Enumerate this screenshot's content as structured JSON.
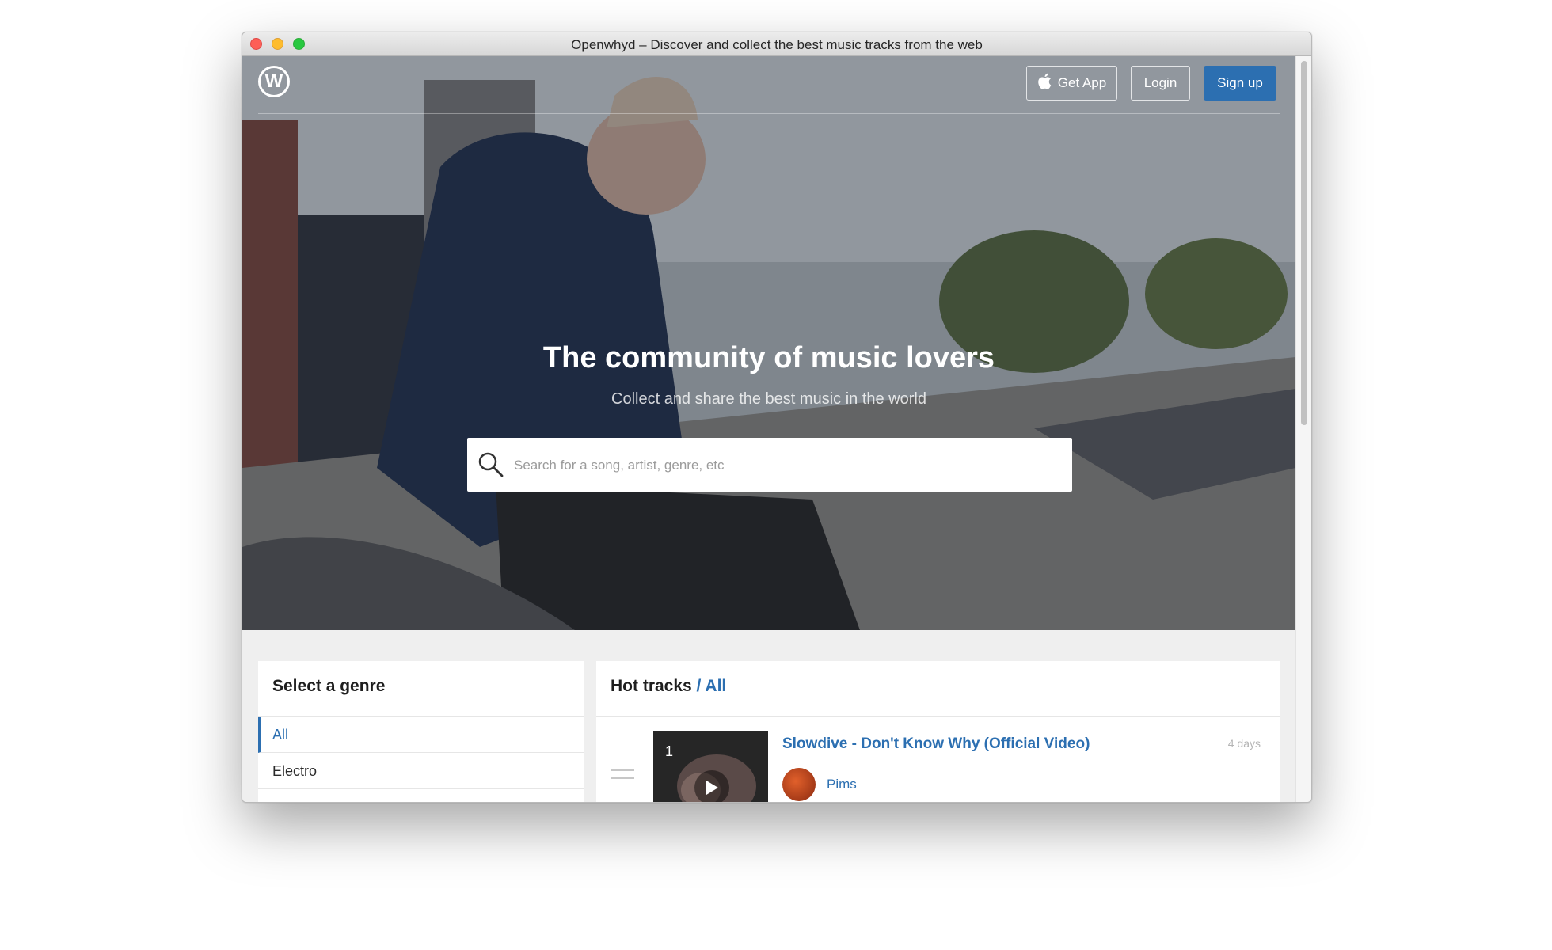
{
  "window": {
    "title": "Openwhyd – Discover and collect the best music tracks from the web"
  },
  "header": {
    "logo_letter": "W",
    "get_app_label": "Get App",
    "login_label": "Login",
    "signup_label": "Sign up"
  },
  "hero": {
    "title": "The community of music lovers",
    "subtitle": "Collect and share the best music in the world",
    "search_placeholder": "Search for a song, artist, genre, etc"
  },
  "genre_panel": {
    "title": "Select a genre",
    "items": [
      {
        "label": "All",
        "active": true
      },
      {
        "label": "Electro",
        "active": false
      }
    ]
  },
  "hot_tracks": {
    "title": "Hot tracks",
    "filter": "/ All",
    "tracks": [
      {
        "rank": "1",
        "title": "Slowdive - Don't Know Why (Official Video)",
        "user": "Pims",
        "age": "4 days"
      }
    ]
  },
  "colors": {
    "accent": "#2c6fb1",
    "signup_bg": "#2c6fb1"
  }
}
